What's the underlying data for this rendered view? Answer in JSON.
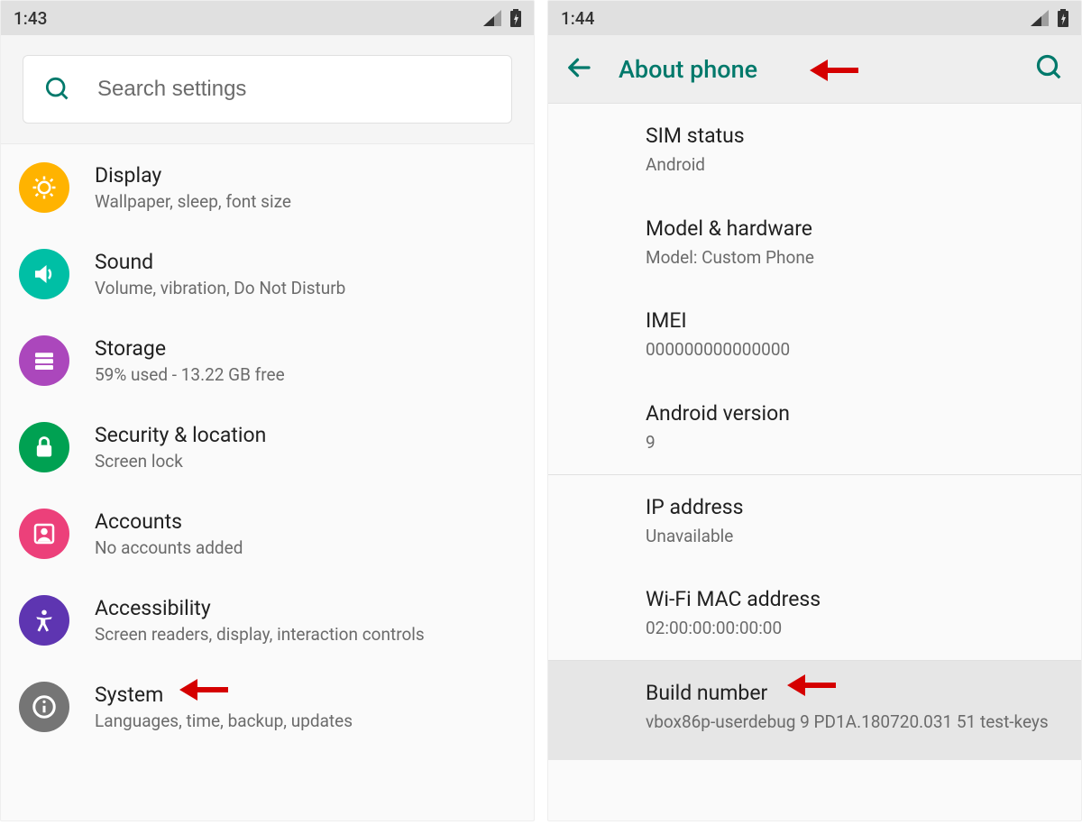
{
  "left": {
    "status_time": "1:43",
    "search_placeholder": "Search settings",
    "items": [
      {
        "title": "Display",
        "sub": "Wallpaper, sleep, font size"
      },
      {
        "title": "Sound",
        "sub": "Volume, vibration, Do Not Disturb"
      },
      {
        "title": "Storage",
        "sub": "59% used - 13.22 GB free"
      },
      {
        "title": "Security & location",
        "sub": "Screen lock"
      },
      {
        "title": "Accounts",
        "sub": "No accounts added"
      },
      {
        "title": "Accessibility",
        "sub": "Screen readers, display, interaction controls"
      },
      {
        "title": "System",
        "sub": "Languages, time, backup, updates"
      }
    ]
  },
  "right": {
    "status_time": "1:44",
    "appbar_title": "About phone",
    "items": [
      {
        "title": "SIM status",
        "sub": "Android"
      },
      {
        "title": "Model & hardware",
        "sub": "Model: Custom Phone"
      },
      {
        "title": "IMEI",
        "sub": "000000000000000"
      },
      {
        "title": "Android version",
        "sub": "9"
      },
      {
        "title": "IP address",
        "sub": "Unavailable"
      },
      {
        "title": "Wi-Fi MAC address",
        "sub": "02:00:00:00:00:00"
      },
      {
        "title": "Build number",
        "sub": "vbox86p-userdebug 9 PD1A.180720.031 51 test-keys"
      }
    ]
  },
  "colors": {
    "teal": "#00796b",
    "red": "#d50000"
  }
}
